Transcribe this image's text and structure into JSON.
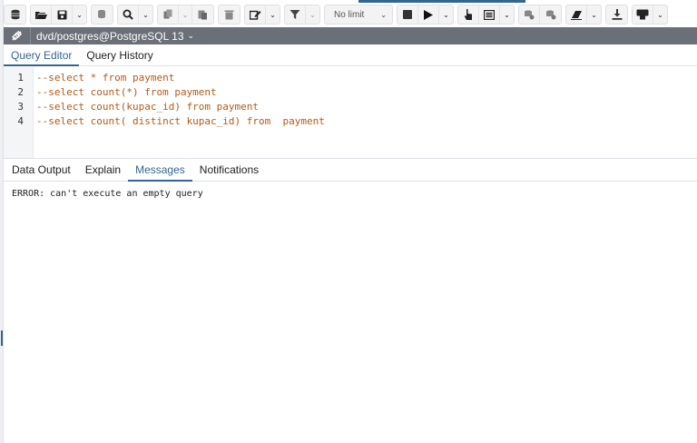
{
  "toolbar": {
    "limit_value": "No limit",
    "icons": [
      "open-folder",
      "save",
      "database-plus",
      "search",
      "copy",
      "paste",
      "trash",
      "edit",
      "filter",
      "stop",
      "play",
      "pointer",
      "list",
      "execute-options",
      "clear",
      "download",
      "macros"
    ]
  },
  "connection": {
    "label": "dvd/postgres@PostgreSQL 13"
  },
  "editor_tabs": [
    {
      "label": "Query Editor"
    },
    {
      "label": "Query History"
    }
  ],
  "editor": {
    "lines": [
      {
        "num": "1",
        "text": "--select * from payment"
      },
      {
        "num": "2",
        "text": "--select count(*) from payment"
      },
      {
        "num": "3",
        "text": "--select count(kupac_id) from payment"
      },
      {
        "num": "4",
        "text": "--select count( distinct kupac_id) from  payment"
      }
    ]
  },
  "output_tabs": [
    {
      "label": "Data Output"
    },
    {
      "label": "Explain"
    },
    {
      "label": "Messages"
    },
    {
      "label": "Notifications"
    }
  ],
  "messages": {
    "text": "ERROR: can't execute an empty query"
  },
  "colors": {
    "accent": "#326690",
    "comment": "#b35a1a",
    "conn_bar": "#6b6f77"
  }
}
